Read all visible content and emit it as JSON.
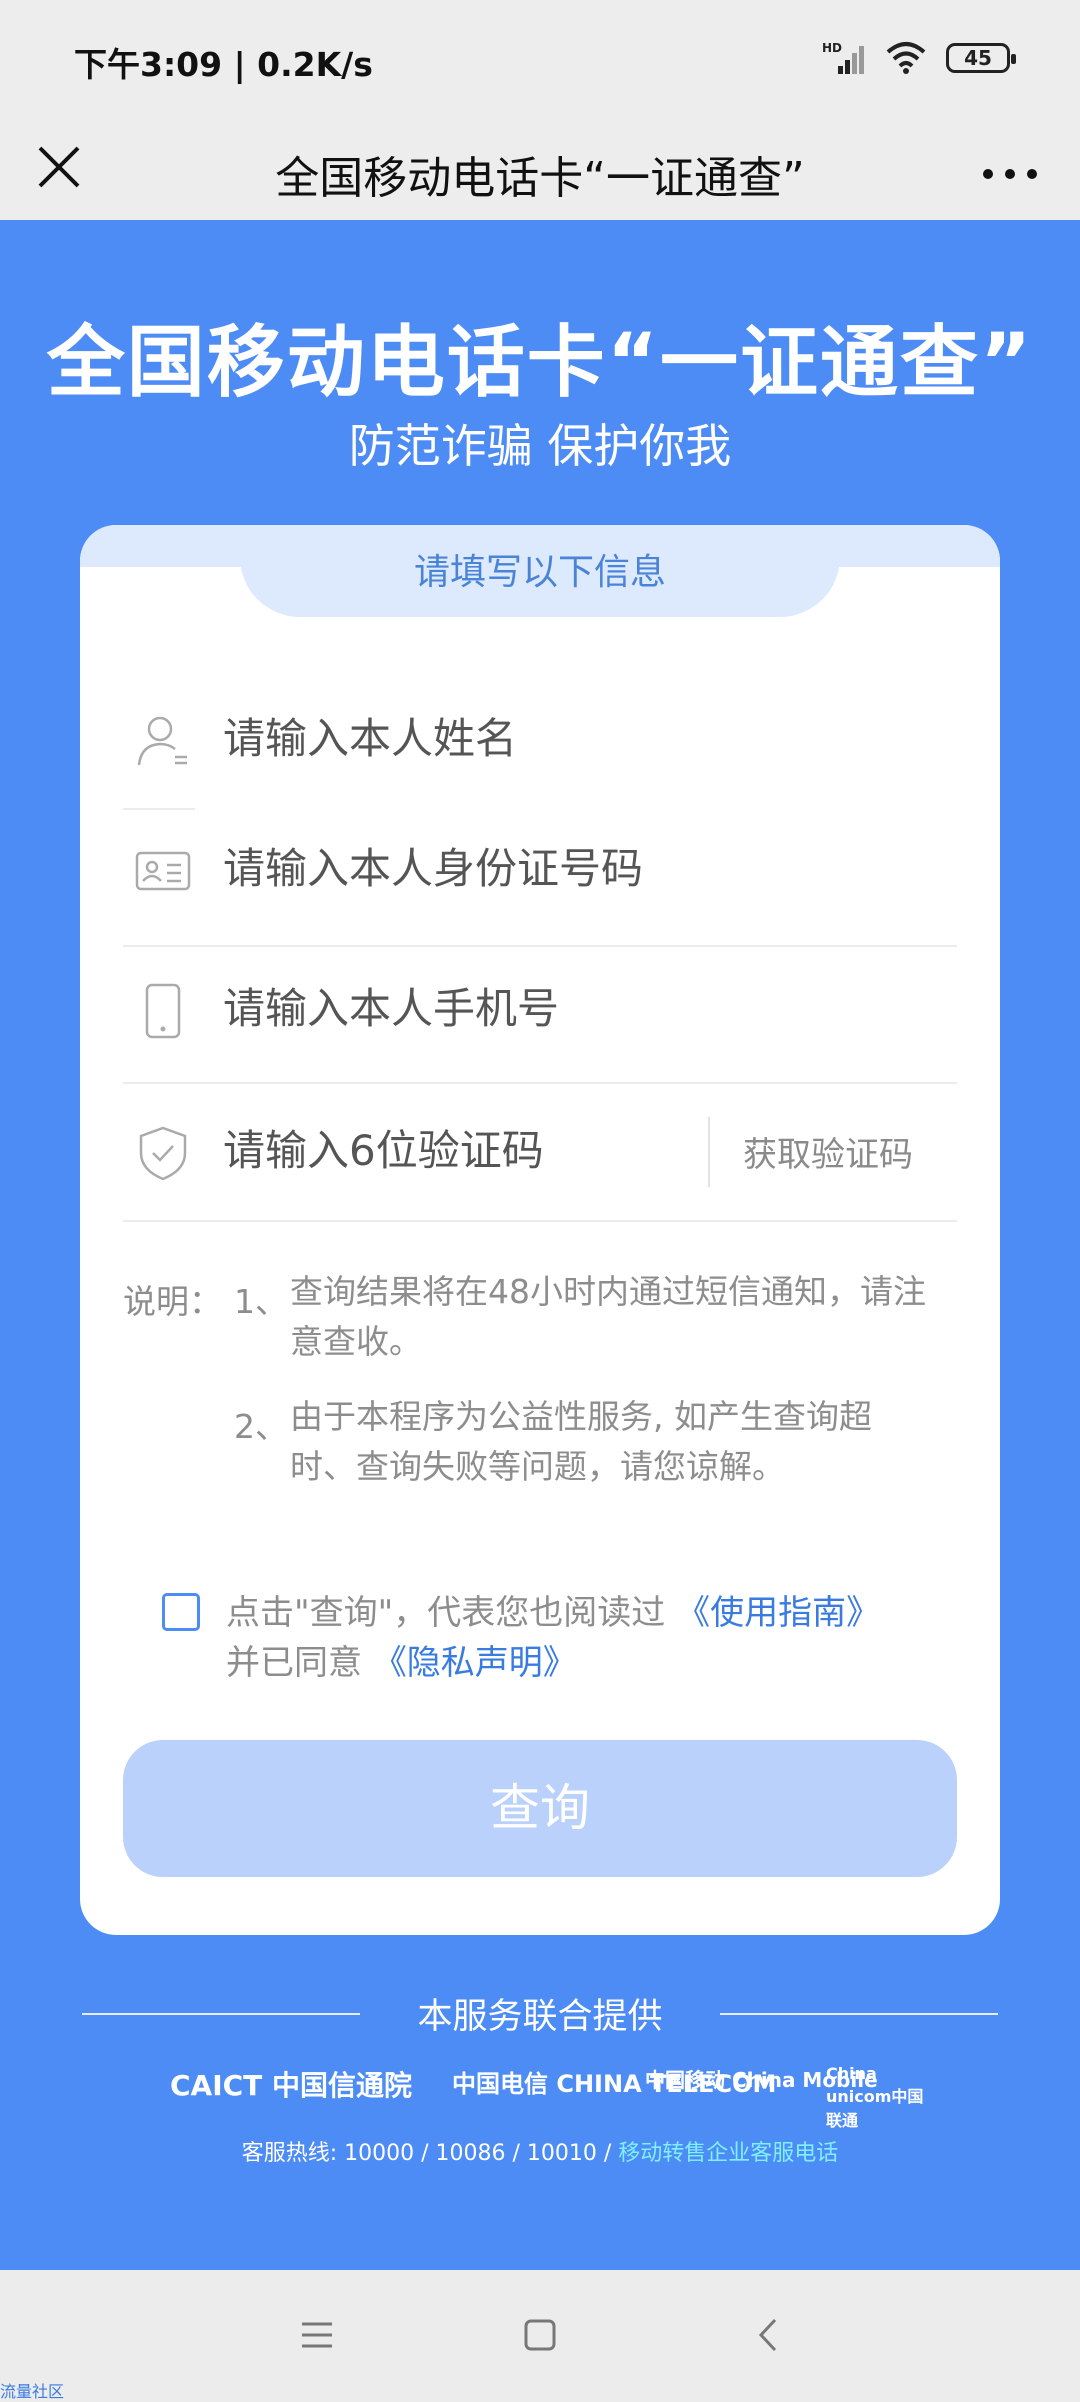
{
  "status_bar": {
    "time_speed": "下午3:09 | 0.2K/s",
    "battery": "45",
    "network": "HD"
  },
  "title_bar": {
    "title": "全国移动电话卡“一证通查”"
  },
  "hero": {
    "title": "全国移动电话卡“一证通查”",
    "subtitle": "防范诈骗 保护你我"
  },
  "form": {
    "header": "请填写以下信息",
    "name_placeholder": "请输入本人姓名",
    "id_placeholder": "请输入本人身份证号码",
    "phone_placeholder": "请输入本人手机号",
    "code_placeholder": "请输入6位验证码",
    "get_code_label": "获取验证码"
  },
  "notes": {
    "label": "说明：",
    "items": [
      {
        "num": "1、",
        "text": "查询结果将在48小时内通过短信通知，请注意查收。"
      },
      {
        "num": "2、",
        "text": "由于本程序为公益性服务, 如产生查询超时、查询失败等问题，请您谅解。"
      }
    ]
  },
  "agreement": {
    "prefix": "点击\"查询\"，代表您也阅读过",
    "guide_link": "《使用指南》",
    "middle": "并已同意",
    "privacy_link": "《隐私声明》",
    "checked": false
  },
  "query_button": "查询",
  "footer": {
    "label": "本服务联合提供",
    "logos": [
      "CAICT 中国信通院",
      "中国电信 CHINA TELECOM",
      "中国移动 China Mobile",
      "China unicom中国联通"
    ],
    "hotline_prefix": "客服热线: 10000 / 10086 / 10010 / ",
    "hotline_link": "移动转售企业客服电话"
  },
  "corner_text": "流量社区",
  "colors": {
    "blue": "#4e8cf5",
    "button_disabled": "#b9d1fb",
    "link": "#3a7be0"
  }
}
